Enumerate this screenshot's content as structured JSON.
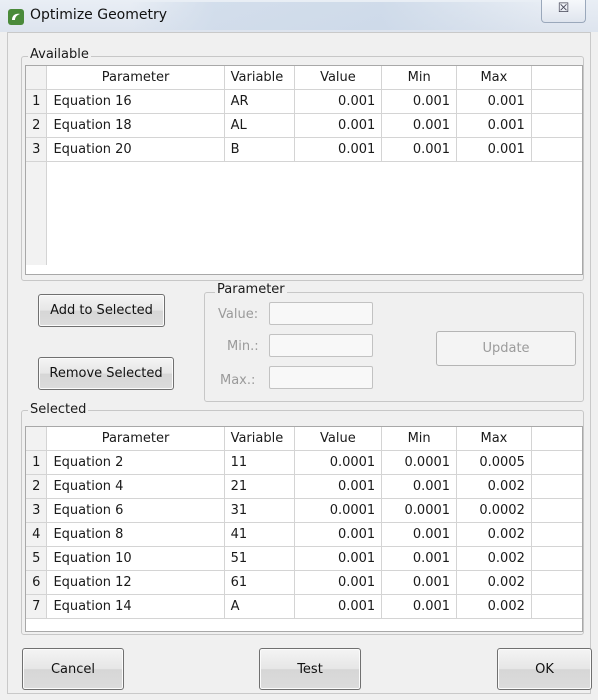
{
  "window": {
    "title": "Optimize Geometry",
    "close_glyph": "☒"
  },
  "available": {
    "legend": "Available",
    "columns": [
      "Parameter",
      "Variable",
      "Value",
      "Min",
      "Max"
    ],
    "rows": [
      {
        "num": "1",
        "parameter": "Equation 16",
        "variable": "AR",
        "value": "0.001",
        "min": "0.001",
        "max": "0.001"
      },
      {
        "num": "2",
        "parameter": "Equation 18",
        "variable": "AL",
        "value": "0.001",
        "min": "0.001",
        "max": "0.001"
      },
      {
        "num": "3",
        "parameter": "Equation 20",
        "variable": "B",
        "value": "0.001",
        "min": "0.001",
        "max": "0.001"
      }
    ]
  },
  "actions": {
    "add_label": "Add to Selected",
    "remove_label": "Remove Selected"
  },
  "parameter_box": {
    "legend": "Parameter",
    "value_label": "Value:",
    "min_label": "Min.:",
    "max_label": "Max.:",
    "value": "",
    "min": "",
    "max": "",
    "update_label": "Update"
  },
  "selected": {
    "legend": "Selected",
    "columns": [
      "Parameter",
      "Variable",
      "Value",
      "Min",
      "Max"
    ],
    "rows": [
      {
        "num": "1",
        "parameter": "Equation  2",
        "variable": "11",
        "value": "0.0001",
        "min": "0.0001",
        "max": "0.0005"
      },
      {
        "num": "2",
        "parameter": "Equation  4",
        "variable": "21",
        "value": "0.001",
        "min": "0.001",
        "max": "0.002"
      },
      {
        "num": "3",
        "parameter": "Equation  6",
        "variable": "31",
        "value": "0.0001",
        "min": "0.0001",
        "max": "0.0002"
      },
      {
        "num": "4",
        "parameter": "Equation  8",
        "variable": "41",
        "value": "0.001",
        "min": "0.001",
        "max": "0.002"
      },
      {
        "num": "5",
        "parameter": "Equation 10",
        "variable": "51",
        "value": "0.001",
        "min": "0.001",
        "max": "0.002"
      },
      {
        "num": "6",
        "parameter": "Equation 12",
        "variable": "61",
        "value": "0.001",
        "min": "0.001",
        "max": "0.002"
      },
      {
        "num": "7",
        "parameter": "Equation 14",
        "variable": "A",
        "value": "0.001",
        "min": "0.001",
        "max": "0.002"
      }
    ]
  },
  "footer": {
    "cancel_label": "Cancel",
    "test_label": "Test",
    "ok_label": "OK"
  }
}
